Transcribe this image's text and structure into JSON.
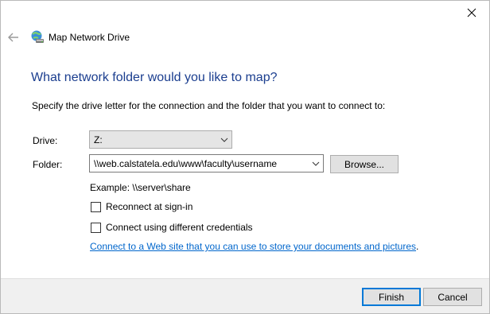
{
  "window": {
    "title": "Map Network Drive"
  },
  "content": {
    "heading": "What network folder would you like to map?",
    "instruction": "Specify the drive letter for the connection and the folder that you want to connect to:",
    "drive": {
      "label": "Drive:",
      "value": "Z:"
    },
    "folder": {
      "label": "Folder:",
      "value": "\\\\web.calstatela.edu\\www\\faculty\\username"
    },
    "browse_label": "Browse...",
    "example": "Example: \\\\server\\share",
    "reconnect_label": "Reconnect at sign-in",
    "different_credentials_label": "Connect using different credentials",
    "web_link": "Connect to a Web site that you can use to store your documents and pictures",
    "web_link_suffix": "."
  },
  "footer": {
    "finish_label": "Finish",
    "cancel_label": "Cancel"
  },
  "icons": {
    "close": "close-icon",
    "back": "back-arrow-icon",
    "title": "network-drive-icon",
    "dropdown": "chevron-down-icon"
  },
  "colors": {
    "heading": "#1b3e8f",
    "link": "#0066cc",
    "default_button_border": "#0078d7"
  },
  "state": {
    "reconnect_checked": false,
    "different_credentials_checked": false
  }
}
